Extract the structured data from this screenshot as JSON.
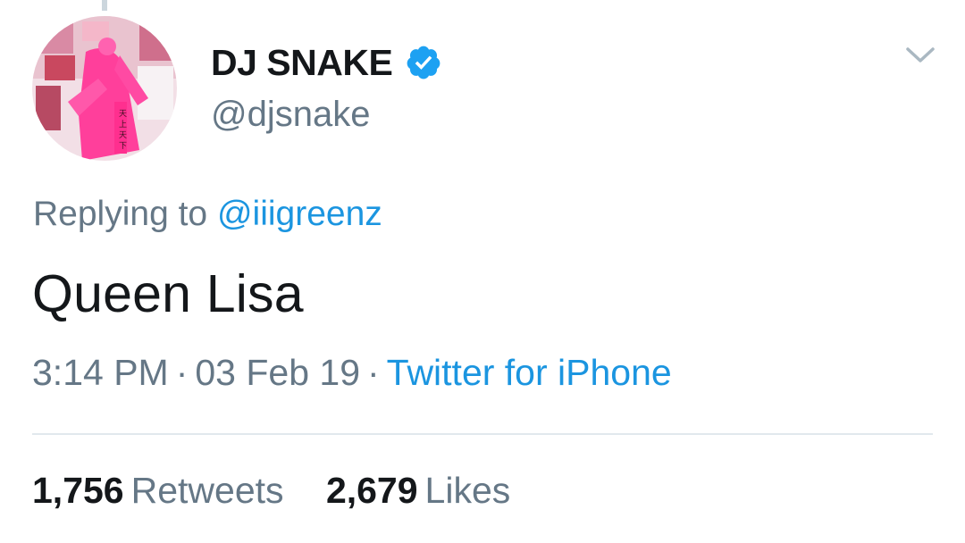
{
  "tweet": {
    "display_name": "DJ SNAKE",
    "handle": "@djsnake",
    "verified": true,
    "reply_prefix": "Replying to",
    "reply_mention": "@iiigreenz",
    "text": "Queen Lisa",
    "time": "3:14 PM",
    "date": "03 Feb 19",
    "separator": "·",
    "source": "Twitter for iPhone"
  },
  "stats": {
    "retweets_count": "1,756",
    "retweets_label": "Retweets",
    "likes_count": "2,679",
    "likes_label": "Likes"
  },
  "icons": {
    "verified": "verified-badge-icon",
    "caret": "chevron-down-icon"
  },
  "colors": {
    "primary_text": "#14171a",
    "secondary_text": "#657786",
    "link": "#1b95e0",
    "verified": "#1da1f2",
    "divider": "#e1e8ed"
  }
}
